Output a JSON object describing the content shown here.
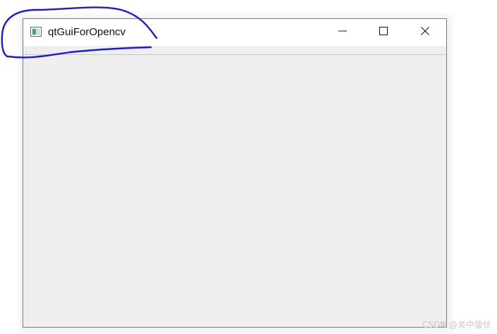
{
  "window": {
    "title": "qtGuiForOpencv",
    "app_icon": "qt-window-icon",
    "controls": {
      "minimize_icon": "minimize-icon",
      "maximize_icon": "maximize-icon",
      "close_icon": "close-icon"
    }
  },
  "colors": {
    "titlebar": "#ffffff",
    "client_background": "#efefef",
    "window_border": "#7a7a7a",
    "annotation_stroke": "#1a1adb"
  },
  "watermark": "CSDN @关中蛰伏"
}
